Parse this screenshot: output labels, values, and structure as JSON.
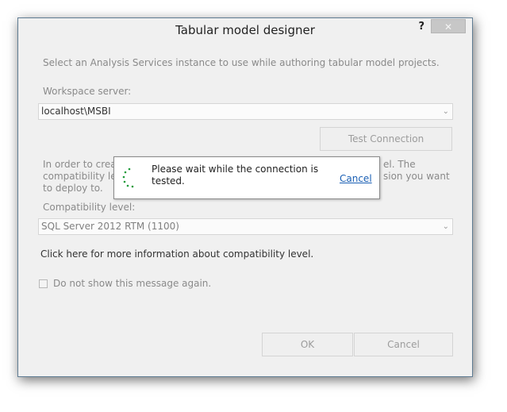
{
  "dialog": {
    "title": "Tabular model designer",
    "help_label": "?",
    "close_label": "✕",
    "instruction": "Select an Analysis Services instance to use while authoring tabular model projects.",
    "workspace_label": "Workspace server:",
    "workspace_value": "localhost\\MSBI",
    "test_connection_label": "Test Connection",
    "compat_intro_left_1": "In order to crea",
    "compat_intro_left_2": "compatibility lev",
    "compat_intro_left_3": "to deploy to.",
    "compat_intro_right_1": "el. The",
    "compat_intro_right_2": "sion you want",
    "compat_label": "Compatibility level:",
    "compat_value": "SQL Server 2012 RTM (1100)",
    "info_link": "Click here for more information about compatibility level.",
    "dont_show_label": "Do not show this message again.",
    "ok_label": "OK",
    "cancel_label": "Cancel"
  },
  "popup": {
    "message": "Please wait while the connection is tested.",
    "cancel_label": "Cancel"
  },
  "icons": {
    "spinner": "loading-spinner-icon",
    "dropdown": "chevron-down-icon",
    "spinner_color": "#1f9a3a"
  }
}
